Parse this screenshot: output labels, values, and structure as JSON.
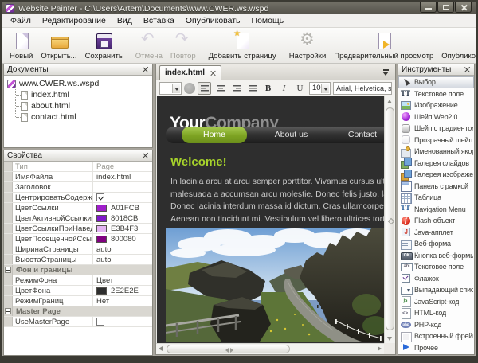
{
  "window": {
    "title": "Website Painter - C:\\Users\\Artem\\Documents\\www.CWER.ws.wspd"
  },
  "menu": {
    "items": [
      "Файл",
      "Редактирование",
      "Вид",
      "Вставка",
      "Опубликовать",
      "Помощь"
    ]
  },
  "toolbar": {
    "buttons": [
      {
        "label": "Новый",
        "icon": "new-page-icon",
        "enabled": true,
        "sep_after": false
      },
      {
        "label": "Открыть...",
        "icon": "open-folder-icon",
        "enabled": true,
        "sep_after": false
      },
      {
        "label": "Сохранить",
        "icon": "save-icon",
        "enabled": true,
        "sep_after": true
      },
      {
        "label": "Отмена",
        "icon": "undo-icon",
        "enabled": false,
        "sep_after": false
      },
      {
        "label": "Повтор",
        "icon": "redo-icon",
        "enabled": false,
        "sep_after": true
      },
      {
        "label": "Добавить страницу",
        "icon": "add-page-icon",
        "enabled": true,
        "sep_after": true
      },
      {
        "label": "Настройки",
        "icon": "settings-gear-icon",
        "enabled": true,
        "sep_after": false
      },
      {
        "label": "Предварительный просмотр",
        "icon": "preview-icon",
        "enabled": true,
        "sep_after": false
      },
      {
        "label": "Опубликовать на локальный диск",
        "icon": "publish-disk-icon",
        "enabled": true,
        "sep_after": false
      }
    ]
  },
  "documents_panel": {
    "title": "Документы",
    "root": "www.CWER.ws.wspd",
    "files": [
      "index.html",
      "about.html",
      "contact.html"
    ]
  },
  "properties_panel": {
    "title": "Свойства",
    "rows": [
      {
        "label": "Тип",
        "value": "Page",
        "kind": "readonly"
      },
      {
        "label": "ИмяФайла",
        "value": "index.html",
        "kind": "text"
      },
      {
        "label": "Заголовок",
        "value": "",
        "kind": "text"
      },
      {
        "label": "ЦентрироватьСодержимое",
        "value": "checked",
        "kind": "checkbox"
      },
      {
        "label": "ЦветСсылки",
        "value": "A01FCB",
        "kind": "color",
        "hex": "#A01FCB"
      },
      {
        "label": "ЦветАктивнойСсылки",
        "value": "8018CB",
        "kind": "color",
        "hex": "#8018CB"
      },
      {
        "label": "ЦветСсылкиПриНаведении",
        "value": "E3B4F3",
        "kind": "color",
        "hex": "#E3B4F3"
      },
      {
        "label": "ЦветПосещеннойСсылки",
        "value": "800080",
        "kind": "color",
        "hex": "#800080"
      },
      {
        "label": "ШиринаСтраницы",
        "value": "auto",
        "kind": "text"
      },
      {
        "label": "ВысотаСтраницы",
        "value": "auto",
        "kind": "text"
      },
      {
        "label": "Фон и границы",
        "kind": "group"
      },
      {
        "label": "РежимФона",
        "value": "Цвет",
        "kind": "text"
      },
      {
        "label": "ЦветФона",
        "value": "2E2E2E",
        "kind": "color",
        "hex": "#2E2E2E"
      },
      {
        "label": "РежимГраниц",
        "value": "Нет",
        "kind": "text"
      },
      {
        "label": "Master Page",
        "kind": "group"
      },
      {
        "label": "UseMasterPage",
        "value": "unchecked",
        "kind": "checkbox"
      }
    ]
  },
  "editor": {
    "tab_label": "index.html",
    "format_toolbar": {
      "bold": "B",
      "italic": "I",
      "underline": "U",
      "font_size": "10",
      "font_family": "Arial, Helvetica, sans-serif"
    }
  },
  "site_preview": {
    "logo_primary": "Your",
    "logo_secondary": "Company",
    "nav_items": [
      {
        "label": "Home",
        "active": true
      },
      {
        "label": "About us",
        "active": false
      },
      {
        "label": "Contact",
        "active": false
      }
    ],
    "heading": "Welcome!",
    "paragraph_lines": [
      "In lacinia arcu at arcu semper porttitor. Vivamus cursus ultrices soll",
      "malesuada a accumsan arcu molestie. Donec felis justo, lacinia quis",
      "Donec lacinia interdum massa id dictum. Cras ullamcorper lectus in",
      "Aenean non tincidunt mi. Vestibulum vel libero ultrices tortor facilis"
    ],
    "colors": {
      "page_background": "#2E2E2E",
      "heading_green": "#A6D22B",
      "nav_active_green": "#7DA322"
    }
  },
  "tools_panel": {
    "title": "Инструменты",
    "items": [
      {
        "label": "Выбор",
        "icon": "cursor-icon",
        "selected": true
      },
      {
        "label": "Текстовое поле",
        "icon": "text-field-icon"
      },
      {
        "label": "Изображение",
        "icon": "image-icon"
      },
      {
        "label": "Шейп Web2.0",
        "icon": "web2-shape-icon"
      },
      {
        "label": "Шейп с градиентом",
        "icon": "gradient-shape-icon"
      },
      {
        "label": "Прозрачный шейп",
        "icon": "transparent-shape-icon"
      },
      {
        "label": "Именованный якорь",
        "icon": "anchor-icon"
      },
      {
        "label": "Галерея слайдов",
        "icon": "slide-gallery-icon"
      },
      {
        "label": "Галерея изображений",
        "icon": "image-gallery-icon"
      },
      {
        "label": "Панель с рамкой",
        "icon": "framed-panel-icon"
      },
      {
        "label": "Таблица",
        "icon": "table-icon"
      },
      {
        "label": "Navigation Menu",
        "icon": "nav-menu-icon"
      },
      {
        "label": "Flash-объект",
        "icon": "flash-icon"
      },
      {
        "label": "Java-апплет",
        "icon": "java-icon"
      },
      {
        "label": "Веб-форма",
        "icon": "web-form-icon"
      },
      {
        "label": "Кнопка веб-формы",
        "icon": "form-button-icon"
      },
      {
        "label": "Текстовое поле",
        "icon": "form-textfield-icon"
      },
      {
        "label": "Флажок",
        "icon": "checkbox-icon"
      },
      {
        "label": "Выпадающий список",
        "icon": "dropdown-icon"
      },
      {
        "label": "JavaScript-код",
        "icon": "javascript-icon"
      },
      {
        "label": "HTML-код",
        "icon": "html-icon"
      },
      {
        "label": "PHP-код",
        "icon": "php-icon"
      },
      {
        "label": "Встроенный фрейм",
        "icon": "iframe-icon"
      },
      {
        "label": "Прочее",
        "icon": "more-expander-icon"
      }
    ]
  }
}
